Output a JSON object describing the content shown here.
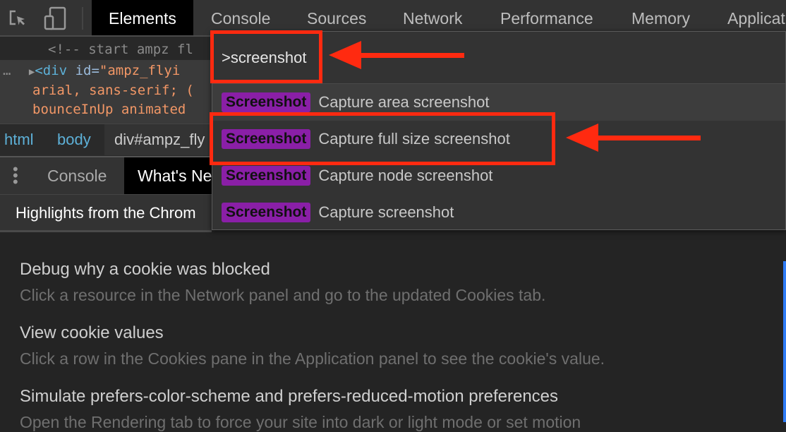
{
  "toolbar": {
    "tabs": [
      "Elements",
      "Console",
      "Sources",
      "Network",
      "Performance",
      "Memory",
      "Applicat"
    ],
    "active": "Elements"
  },
  "code": {
    "line1": "<!-- start ampz fl",
    "line2_tag": "<div",
    "line2_attr": "id=",
    "line2_val": "\"ampz_flyi",
    "line3": "arial, sans-serif; (",
    "line4": "bounceInUp animated"
  },
  "breadcrumb": [
    "html",
    "body",
    "div#ampz_fly"
  ],
  "drawer": {
    "tabs": [
      "Console",
      "What's Ne"
    ],
    "active": "What's Ne",
    "header": "Highlights from the Chrom"
  },
  "command_menu": {
    "query": ">screenshot",
    "items": [
      {
        "badge": "Screenshot",
        "label": "Capture area screenshot"
      },
      {
        "badge": "Screenshot",
        "label": "Capture full size screenshot"
      },
      {
        "badge": "Screenshot",
        "label": "Capture node screenshot"
      },
      {
        "badge": "Screenshot",
        "label": "Capture screenshot"
      }
    ]
  },
  "whats_new": [
    {
      "title": "Debug why a cookie was blocked",
      "desc": "Click a resource in the Network panel and go to the updated Cookies tab."
    },
    {
      "title": "View cookie values",
      "desc": "Click a row in the Cookies pane in the Application panel to see the cookie's value."
    },
    {
      "title": "Simulate prefers-color-scheme and prefers-reduced-motion preferences",
      "desc": "Open the Rendering tab to force your site into dark or light mode or set motion"
    }
  ],
  "colors": {
    "annotation": "#ff2a10",
    "badge": "#8a1fa7",
    "accent": "#2f7cf6"
  }
}
